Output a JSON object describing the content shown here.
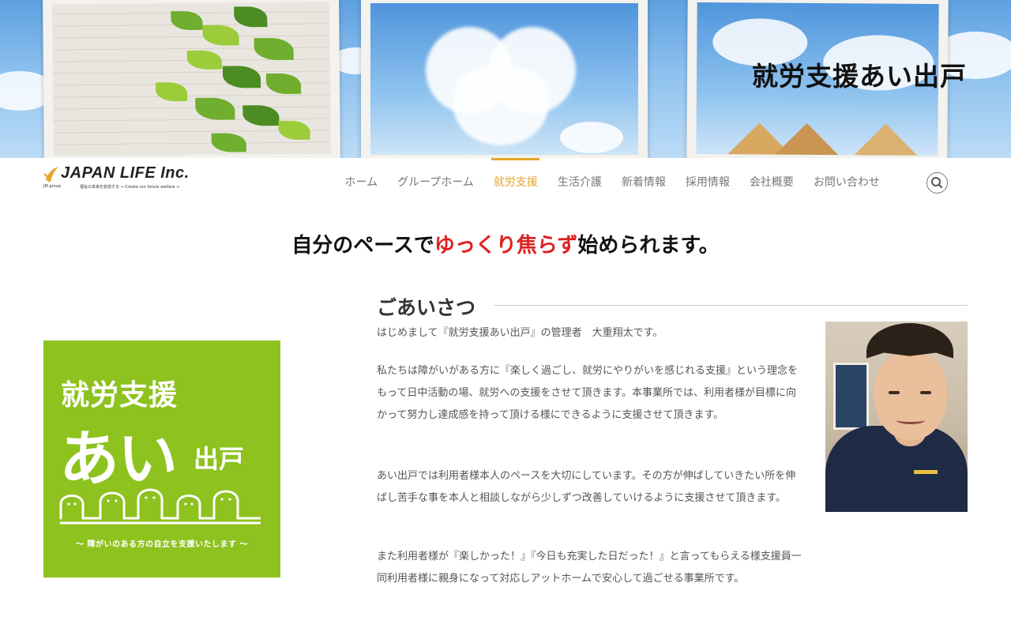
{
  "hero": {
    "title": "就労支援あい出戸"
  },
  "brand": {
    "name": "JAPAN LIFE Inc.",
    "group": "JM group",
    "tagline": "福祉の未来を創造する ⇒ Create our future welfare ⇒"
  },
  "nav": {
    "items": [
      {
        "label": "ホーム",
        "active": false
      },
      {
        "label": "グループホーム",
        "active": false
      },
      {
        "label": "就労支援",
        "active": true
      },
      {
        "label": "生活介護",
        "active": false
      },
      {
        "label": "新着情報",
        "active": false
      },
      {
        "label": "採用情報",
        "active": false
      },
      {
        "label": "会社概要",
        "active": false
      },
      {
        "label": "お問い合わせ",
        "active": false
      }
    ],
    "search_icon": "search-icon"
  },
  "tagline": {
    "before": "自分のペースで",
    "highlight": "ゆっくり焦らず",
    "after": "始められます。"
  },
  "facility_logo": {
    "line1": "就労支援",
    "line2": "あい",
    "line3": "出戸",
    "caption": "〜 障がいのある方の自立を支援いたします 〜"
  },
  "greeting": {
    "title": "ごあいさつ",
    "paragraphs": [
      "はじめまして『就労支援あい出戸』の管理者　大重翔太です。",
      "私たちは障がいがある方に『楽しく過ごし、就労にやりがいを感じれる支援』という理念をもって日中活動の場、就労への支援をさせて頂きます。本事業所では、利用者様が目標に向かって努力し達成感を持って頂ける様にできるように支援させて頂きます。",
      "あい出戸では利用者様本人のペースを大切にしています。その方が伸ばしていきたい所を伸ばし苦手な事を本人と相談しながら少しずつ改善していけるように支援させて頂きます。",
      "また利用者様が『楽しかった！』『今日も充実した日だった！』と言ってもらえる様支援員一同利用者様に親身になって対応しアットホームで安心して過ごせる事業所です。"
    ]
  },
  "colors": {
    "accent": "#e4a62a",
    "highlight_red": "#e02020",
    "panel_green": "#8dc21f"
  }
}
